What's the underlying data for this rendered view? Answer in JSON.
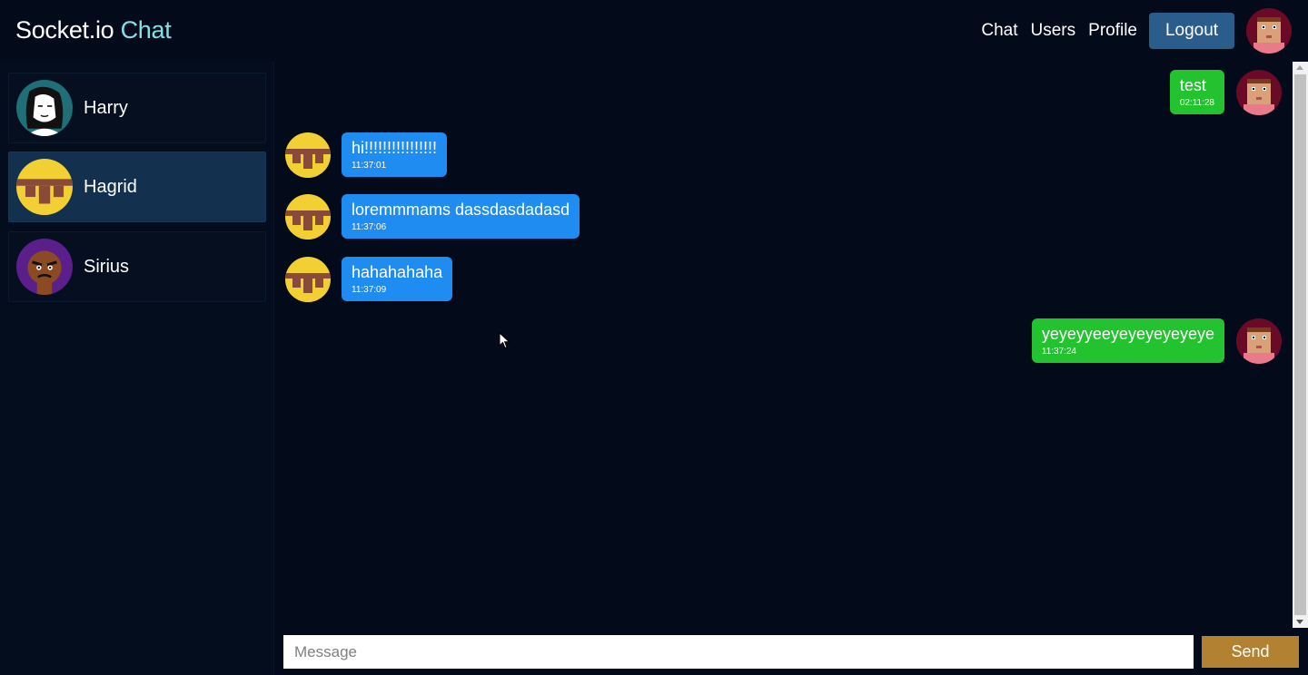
{
  "app": {
    "brand_main": "Socket.io",
    "brand_accent": "Chat"
  },
  "nav": {
    "links": [
      "Chat",
      "Users",
      "Profile"
    ],
    "logout_label": "Logout",
    "avatar_icon": "pixel-face-avatar"
  },
  "sidebar": {
    "users": [
      {
        "name": "Harry",
        "avatar": "sketch-girl-avatar",
        "active": false
      },
      {
        "name": "Hagrid",
        "avatar": "pixel-block-avatar",
        "active": true
      },
      {
        "name": "Sirius",
        "avatar": "angry-man-avatar",
        "active": false
      }
    ]
  },
  "messages": [
    {
      "direction": "out",
      "text": "test",
      "time": "02:11:28",
      "avatar": "pixel-face-avatar"
    },
    {
      "direction": "in",
      "text": "hi!!!!!!!!!!!!!!!!",
      "time": "11:37:01",
      "avatar": "pixel-block-avatar"
    },
    {
      "direction": "in",
      "text": "loremmmams dassdasdadasd",
      "time": "11:37:06",
      "avatar": "pixel-block-avatar"
    },
    {
      "direction": "in",
      "text": "hahahahaha",
      "time": "11:37:09",
      "avatar": "pixel-block-avatar"
    },
    {
      "direction": "out",
      "text": "yeyeyyeeyeyeyeyeyeye",
      "time": "11:37:24",
      "avatar": "pixel-face-avatar"
    }
  ],
  "composer": {
    "placeholder": "Message",
    "value": "",
    "send_label": "Send"
  },
  "colors": {
    "background": "#030b1b",
    "brand_accent": "#7fe3e6",
    "logout": "#2b5d8c",
    "incoming_bubble": "#1e8cf0",
    "outgoing_bubble": "#22c32e",
    "send_button": "#b28132",
    "active_user": "#14304f"
  }
}
